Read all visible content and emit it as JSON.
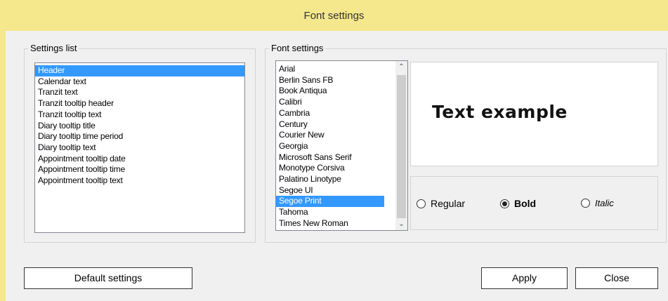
{
  "window": {
    "title": "Font settings"
  },
  "settings_list": {
    "legend": "Settings list",
    "items": [
      "Header",
      "Calendar text",
      "Tranzit text",
      "Tranzit tooltip header",
      "Tranzit tooltip text",
      "Diary tooltip title",
      "Diary tooltip time period",
      "Diary tooltip text",
      "Appointment tooltip date",
      "Appointment tooltip time",
      "Appointment tooltip text"
    ],
    "selected": "Header"
  },
  "font_settings": {
    "legend": "Font settings",
    "fonts": [
      "Arial",
      "Berlin Sans FB",
      "Book Antiqua",
      "Calibri",
      "Cambria",
      "Century",
      "Courier New",
      "Georgia",
      "Microsoft Sans Serif",
      "Monotype Corsiva",
      "Palatino Linotype",
      "Segoe UI",
      "Segoe Print",
      "Tahoma",
      "Times New Roman"
    ],
    "selected": "Segoe Print",
    "preview_text": "Text example",
    "styles": {
      "regular": "Regular",
      "bold": "Bold",
      "italic": "Italic",
      "selected": "bold"
    }
  },
  "buttons": {
    "default": "Default settings",
    "apply": "Apply",
    "close": "Close"
  },
  "icons": {
    "scroll_up": "chevron-up-icon",
    "scroll_down": "chevron-down-icon"
  }
}
